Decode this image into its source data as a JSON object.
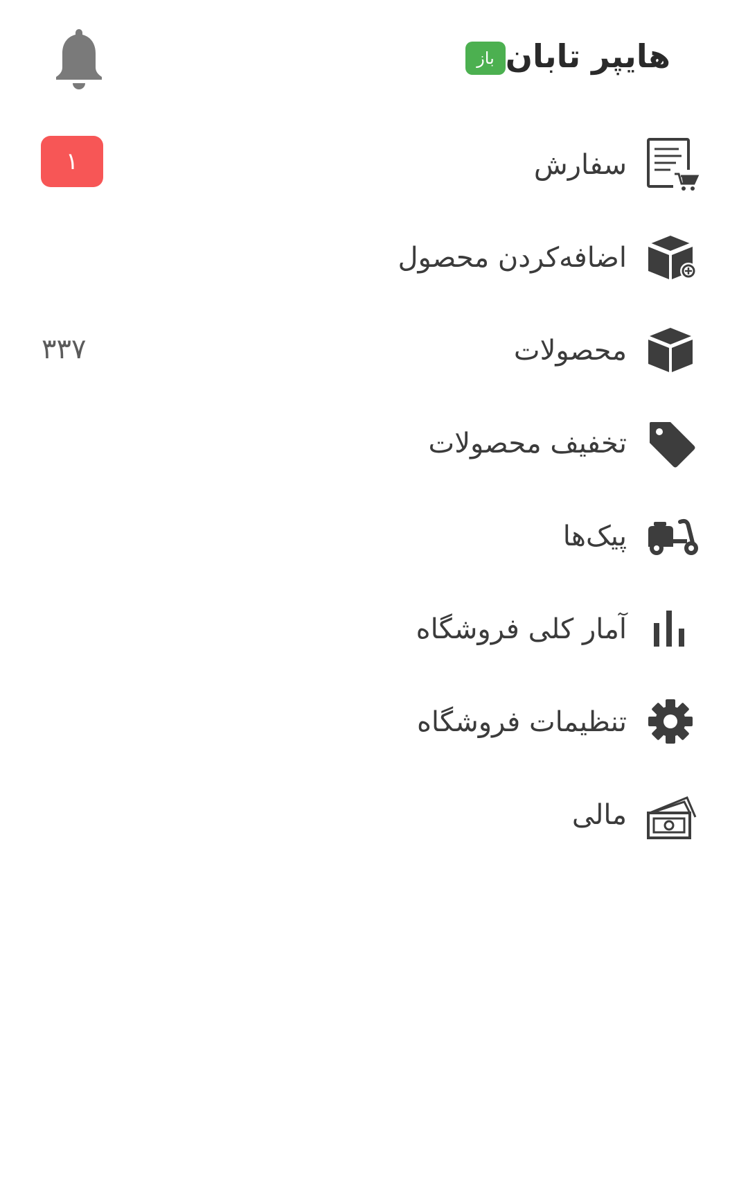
{
  "header": {
    "store_name": "هایپر تابان",
    "status_badge": "باز",
    "notification_icon": "bell-icon"
  },
  "menu": {
    "items": [
      {
        "label": "سفارش",
        "icon": "order-cart-icon",
        "badge": "۱",
        "badge_color": "#f75656"
      },
      {
        "label": "اضافه‌کردن محصول",
        "icon": "box-add-icon"
      },
      {
        "label": "محصولات",
        "icon": "box-icon",
        "count": "۳۳۷"
      },
      {
        "label": "تخفیف محصولات",
        "icon": "tag-icon"
      },
      {
        "label": "پیک‌ها",
        "icon": "scooter-icon"
      },
      {
        "label": "آمار کلی فروشگاه",
        "icon": "bar-chart-icon"
      },
      {
        "label": "تنظیمات فروشگاه",
        "icon": "gear-icon"
      },
      {
        "label": "مالی",
        "icon": "money-icon"
      }
    ]
  },
  "colors": {
    "status_open": "#4cb050",
    "badge_red": "#f75656",
    "icon_gray": "#3d3d3d",
    "bell_gray": "#7a7a7a"
  }
}
